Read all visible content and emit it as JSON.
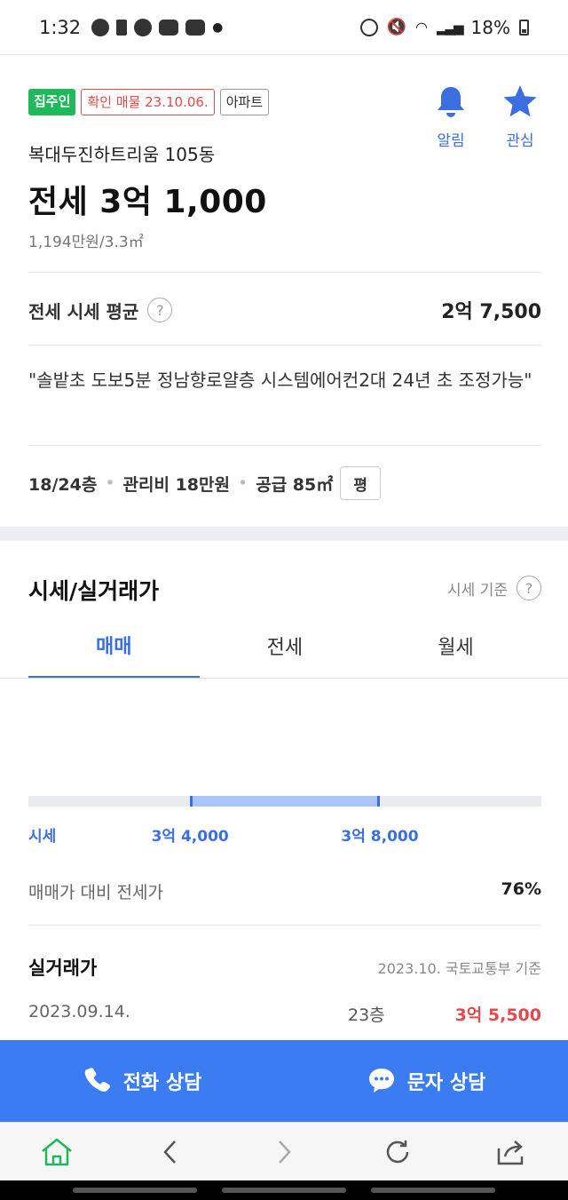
{
  "status_bar": {
    "time": "1:32",
    "battery": "18%"
  },
  "listing": {
    "badges": [
      "집주인",
      "확인 매물 23.10.06.",
      "아파트"
    ],
    "building": "복대두진하트리움 105동",
    "price": "전세 3억 1,000",
    "price_per_area": "1,194만원/3.3㎡",
    "actions": {
      "alarm": "알림",
      "favorite": "관심"
    },
    "avg_label": "전세 시세 평균",
    "avg_help": "?",
    "avg_value": "2억 7,500",
    "description": "\"솔밭초 도보5분 정남향로얄층 시스템에어컨2대 24년 초 조정가능\"",
    "specs": {
      "floor": "18/24층",
      "maintenance": "관리비 18만원",
      "supply": "공급 85㎡",
      "unit_toggle": "평"
    }
  },
  "market": {
    "title": "시세/실거래가",
    "basis": "시세 기준",
    "basis_help": "?",
    "tabs": [
      "매매",
      "전세",
      "월세"
    ],
    "active_tab": 0,
    "range": {
      "label": "시세",
      "low": "3억 4,000",
      "high": "3억 8,000",
      "low_fraction": 0.315,
      "high_fraction": 0.685
    },
    "ratio_label": "매매가 대비 전세가",
    "ratio_value": "76%"
  },
  "deals": {
    "title": "실거래가",
    "basis": "2023.10. 국토교통부 기준",
    "rows": [
      {
        "date": "2023.09.14.",
        "floor": "23층",
        "price": "3억 5,500"
      }
    ]
  },
  "cta": {
    "call": "전화 상담",
    "sms": "문자 상담"
  },
  "colors": {
    "accent": "#3b6fe0",
    "cta": "#3b7cf2",
    "owner_badge": "#1fb85a",
    "alert": "#e24b4b"
  },
  "nav_icons": [
    "home-icon",
    "back-icon",
    "forward-icon",
    "refresh-icon",
    "share-icon"
  ]
}
